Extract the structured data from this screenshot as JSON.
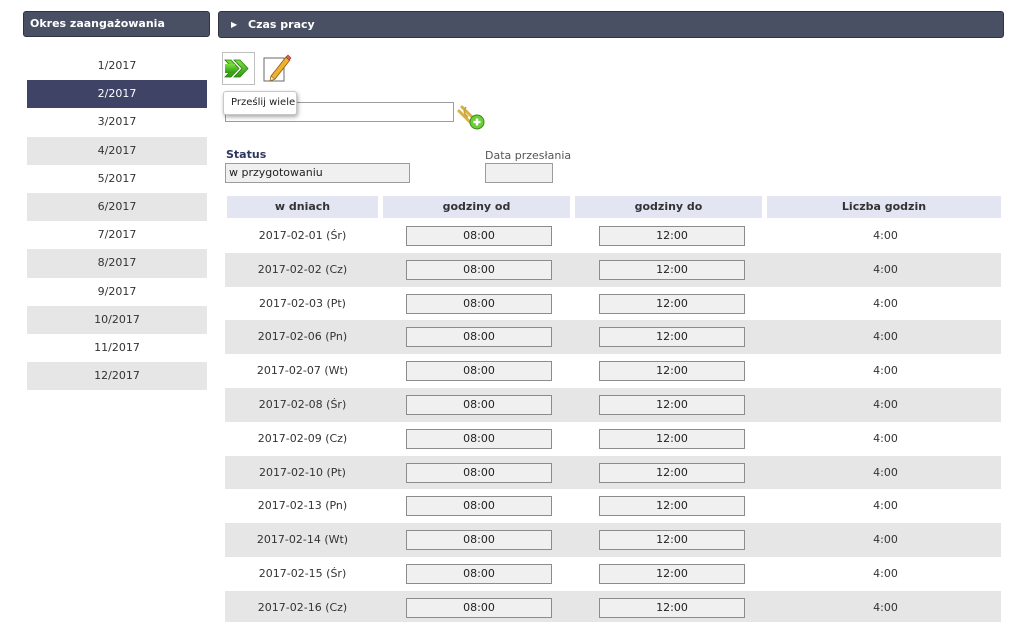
{
  "left_panel": {
    "title": "Okres zaangażowania",
    "active_index": 1,
    "periods": [
      "1/2017",
      "2/2017",
      "3/2017",
      "4/2017",
      "5/2017",
      "6/2017",
      "7/2017",
      "8/2017",
      "9/2017",
      "10/2017",
      "11/2017",
      "12/2017"
    ]
  },
  "right_panel": {
    "title": "Czas pracy"
  },
  "toolbar": {
    "send_icon": "double-arrow-right-icon",
    "edit_icon": "pencil-icon",
    "tooltip": "Prześlij wiele",
    "attach_icon": "attachment-add-icon"
  },
  "form": {
    "status_label": "Status",
    "status_value": "w przygotowaniu",
    "date_label": "Data przesłania",
    "date_value": ""
  },
  "table": {
    "headers": [
      "w dniach",
      "godziny od",
      "godziny do",
      "Liczba godzin"
    ],
    "rows": [
      {
        "date": "2017-02-01 (Śr)",
        "from": "08:00",
        "to": "12:00",
        "hours": "4:00"
      },
      {
        "date": "2017-02-02 (Cz)",
        "from": "08:00",
        "to": "12:00",
        "hours": "4:00"
      },
      {
        "date": "2017-02-03 (Pt)",
        "from": "08:00",
        "to": "12:00",
        "hours": "4:00"
      },
      {
        "date": "2017-02-06 (Pn)",
        "from": "08:00",
        "to": "12:00",
        "hours": "4:00"
      },
      {
        "date": "2017-02-07 (Wt)",
        "from": "08:00",
        "to": "12:00",
        "hours": "4:00"
      },
      {
        "date": "2017-02-08 (Śr)",
        "from": "08:00",
        "to": "12:00",
        "hours": "4:00"
      },
      {
        "date": "2017-02-09 (Cz)",
        "from": "08:00",
        "to": "12:00",
        "hours": "4:00"
      },
      {
        "date": "2017-02-10 (Pt)",
        "from": "08:00",
        "to": "12:00",
        "hours": "4:00"
      },
      {
        "date": "2017-02-13 (Pn)",
        "from": "08:00",
        "to": "12:00",
        "hours": "4:00"
      },
      {
        "date": "2017-02-14 (Wt)",
        "from": "08:00",
        "to": "12:00",
        "hours": "4:00"
      },
      {
        "date": "2017-02-15 (Śr)",
        "from": "08:00",
        "to": "12:00",
        "hours": "4:00"
      },
      {
        "date": "2017-02-16 (Cz)",
        "from": "08:00",
        "to": "12:00",
        "hours": "4:00"
      }
    ]
  },
  "colors": {
    "header_bg": "#4a5064",
    "active_period": "#3f4466",
    "table_head_bg": "#e3e5f3",
    "alt_row": "#e6e6e6"
  }
}
